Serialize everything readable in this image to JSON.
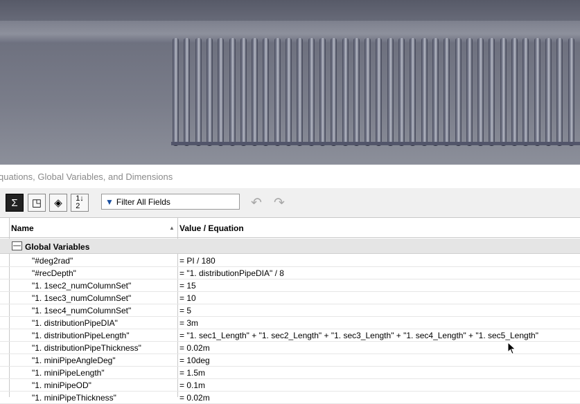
{
  "dialog": {
    "title": "quations, Global Variables, and Dimensions"
  },
  "toolbar": {
    "buttons": [
      {
        "icon": "sigma-icon",
        "active": true
      },
      {
        "icon": "equation-view-icon",
        "active": false
      },
      {
        "icon": "sketch-equation-view-icon",
        "active": false
      },
      {
        "icon": "ordered-view-icon",
        "active": false
      }
    ],
    "filter_placeholder": "Filter All Fields",
    "undo_icon": "undo-icon",
    "redo_icon": "redo-icon"
  },
  "table": {
    "columns": [
      "Name",
      "Value / Equation"
    ],
    "group_label": "Global Variables",
    "rows": [
      {
        "name": "\"#deg2rad\"",
        "value": "= PI / 180"
      },
      {
        "name": "\"#recDepth\"",
        "value": "= \"1. distributionPipeDIA\" / 8"
      },
      {
        "name": "\"1. 1sec2_numColumnSet\"",
        "value": "= 15"
      },
      {
        "name": "\"1. 1sec3_numColumnSet\"",
        "value": "= 10"
      },
      {
        "name": "\"1. 1sec4_numColumnSet\"",
        "value": "= 5"
      },
      {
        "name": "\"1. distributionPipeDIA\"",
        "value": "= 3m"
      },
      {
        "name": "\"1. distributionPipeLength\"",
        "value": "= \"1. sec1_Length\" + \"1. sec2_Length\" + \"1. sec3_Length\" + \"1. sec4_Length\" + \"1. sec5_Length\""
      },
      {
        "name": "\"1. distributionPipeThickness\"",
        "value": "= 0.02m"
      },
      {
        "name": "\"1. miniPipeAngleDeg\"",
        "value": "= 10deg"
      },
      {
        "name": "\"1. miniPipeLength\"",
        "value": "= 1.5m"
      },
      {
        "name": "\"1. miniPipeOD\"",
        "value": "= 0.1m"
      },
      {
        "name": "\"1. miniPipeThickness\"",
        "value": "= 0.02m"
      }
    ]
  },
  "colors": {
    "viewport": "#6a6d7c",
    "group_row": "#e5e5e5",
    "toolbar": "#f0f0f0"
  }
}
